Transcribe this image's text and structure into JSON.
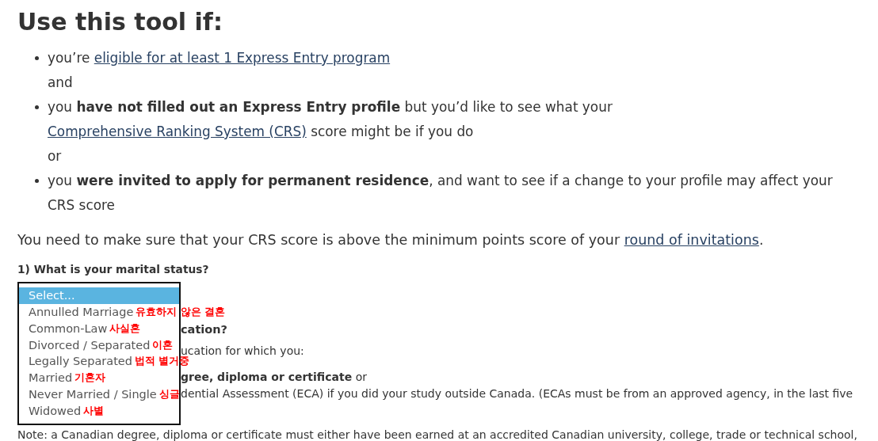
{
  "heading": "Use this tool if:",
  "items": [
    {
      "kind": "bullet",
      "segments": [
        {
          "kind": "text",
          "text": "you’re "
        },
        {
          "kind": "link",
          "text": "eligible for at least 1 Express Entry program"
        }
      ]
    },
    {
      "kind": "connector",
      "text": "and"
    },
    {
      "kind": "bullet",
      "segments": [
        {
          "kind": "text",
          "text": "you **have not filled out an Express Entry profile** but you’d like to see what your "
        },
        {
          "kind": "link",
          "text": "Comprehensive Ranking System (CRS)"
        },
        {
          "kind": "text",
          "text": " score might be if you do"
        }
      ]
    },
    {
      "kind": "connector",
      "text": "or"
    },
    {
      "kind": "bullet",
      "segments": [
        {
          "kind": "text",
          "text": "you **were invited to apply for permanent residence**, and want to see if a change to your profile may affect your CRS score"
        }
      ]
    }
  ],
  "notice": [
    {
      "kind": "text",
      "text": "You need to make sure that your CRS score is above the minimum points score of your "
    },
    {
      "kind": "link",
      "text": "round of invitations"
    },
    {
      "kind": "text",
      "text": "."
    }
  ],
  "question_1": "1) What is your marital status?",
  "options": [
    {
      "label": "Select...",
      "selected": true
    },
    {
      "label": "Annulled Marriage",
      "selected": false,
      "annotation": "유효하지 않은 결혼"
    },
    {
      "label": "Common-Law",
      "selected": false,
      "annotation": "사실혼"
    },
    {
      "label": "Divorced / Separated",
      "selected": false,
      "annotation": "이혼"
    },
    {
      "label": "Legally Separated",
      "selected": false,
      "annotation": "법적 별거중"
    },
    {
      "label": "Married",
      "selected": false,
      "annotation": "기혼자"
    },
    {
      "label": "Never Married / Single",
      "selected": false,
      "annotation": "싱글"
    },
    {
      "label": "Widowed",
      "selected": false,
      "annotation": "사별"
    }
  ],
  "question_2_visible": "cation?",
  "hidden_lines": [
    "ucation for which you:",
    "**gree, diploma or certificate** or",
    "dential Assessment (ECA) if you did your study outside Canada. (ECAs must be from an approved agency, in the last five"
  ],
  "note": "Note: a Canadian degree, diploma or certificate must either have been earned at an accredited Canadian university, college, trade or technical school,"
}
